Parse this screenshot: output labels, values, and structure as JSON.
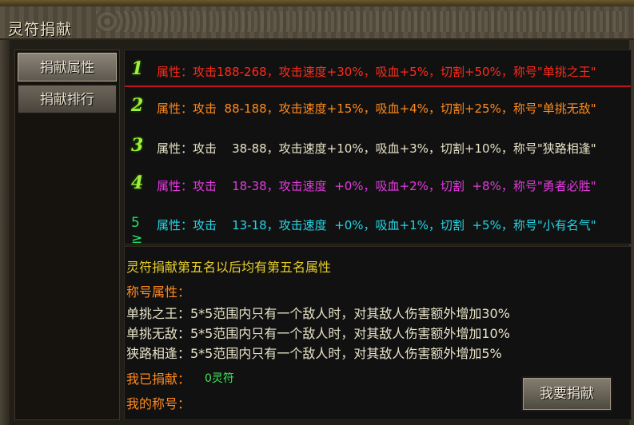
{
  "window": {
    "title": "灵符捐献"
  },
  "tabs": [
    {
      "label": "捐献属性",
      "active": true
    },
    {
      "label": "捐献排行",
      "active": false
    }
  ],
  "ranks": [
    {
      "rank": "1",
      "text": "属性：攻击188-268，攻击速度+30%，吸血+5%，切割+50%，称号\"单挑之王\"",
      "color": "#ff2a1a"
    },
    {
      "rank": "2",
      "text": "属性：攻击  88-188，攻击速度+15%，吸血+4%，切割+25%，称号\"单挑无敌\"",
      "color": "#ff8a1e"
    },
    {
      "rank": "3",
      "text": "属性：攻击    38-88，攻击速度+10%，吸血+3%，切割+10%，称号\"狭路相逢\"",
      "color": "#e6e2c8"
    },
    {
      "rank": "4",
      "text": "属性：攻击    18-38，攻击速度  +0%，吸血+2%，切割  +8%，称号\"勇者必胜\"",
      "color": "#e43ae0"
    },
    {
      "rank": "5 ≥",
      "text": "属性：攻击    13-18，攻击速度  +0%，吸血+1%，切割  +5%，称号\"小有名气\"",
      "color": "#25d6e6"
    }
  ],
  "info": {
    "heading": "灵符捐献第五名以后均有第五名属性",
    "title_attr_label": "称号属性：",
    "title_lines": [
      "单挑之王：5*5范围内只有一个敌人时，对其敌人伤害额外增加30%",
      "单挑无敌：5*5范围内只有一个敌人时，对其敌人伤害额外增加10%",
      "狭路相逢：5*5范围内只有一个敌人时，对其敌人伤害额外增加5%"
    ],
    "donated_label": "我已捐献：",
    "donated_value": "0灵符",
    "my_title_label": "我的称号："
  },
  "donate_button": {
    "label": "我要捐献"
  },
  "colors": {
    "yellow": "#e8cf2a",
    "orange": "#ff8a1e",
    "green": "#3fe65a",
    "text": "#e6e2c8"
  }
}
